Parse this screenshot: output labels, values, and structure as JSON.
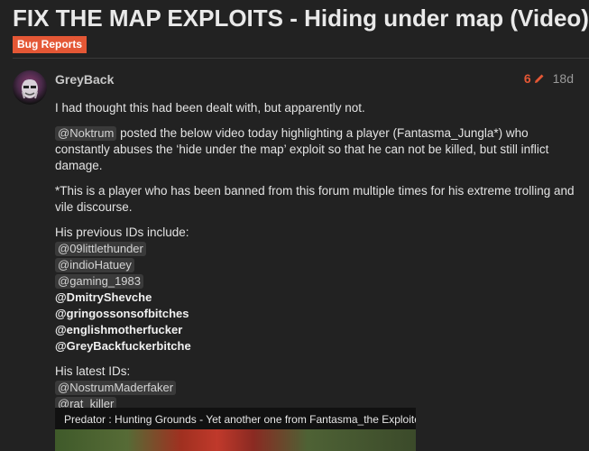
{
  "topic": {
    "title": "FIX THE MAP EXPLOITS - Hiding under map (Video)",
    "category": "Bug Reports"
  },
  "icons": {
    "edit_title": "pencil-icon",
    "edit_count": "pencil-icon"
  },
  "colors": {
    "accent": "#e45735",
    "background": "#222222",
    "mention_bg": "#3a3a3a"
  },
  "post": {
    "username": "GreyBack",
    "edit_count": "6",
    "age": "18d",
    "para1": "I had thought this had been dealt with, but apparently not.",
    "para2_mention": "@Noktrum",
    "para2_text": " posted the below video today highlighting a player (Fantasma_Jungla*) who constantly abuses the ‘hide under the map’ exploit so that he can not be killed, but still inflict damage.",
    "para3": "*This is a player who has been banned from this forum multiple times for his extreme trolling and vile discourse.",
    "previous_ids_label": "His previous IDs include:",
    "previous_ids": [
      {
        "text": "@09littlethunder",
        "style": "chip"
      },
      {
        "text": "@indioHatuey",
        "style": "chip"
      },
      {
        "text": "@gaming_1983",
        "style": "chip"
      },
      {
        "text": "@DmitryShevche",
        "style": "plain"
      },
      {
        "text": "@gringossonsofbitches",
        "style": "plain"
      },
      {
        "text": "@englishmotherfucker",
        "style": "plain"
      },
      {
        "text": "@GreyBackfuckerbitche",
        "style": "plain"
      }
    ],
    "latest_ids_label": "His latest IDs:",
    "latest_ids": [
      {
        "text": "@NostrumMaderfaker",
        "style": "chip"
      },
      {
        "text": "@rat_killer",
        "style": "chip"
      }
    ],
    "video": {
      "title": "Predator : Hunting Grounds - Yet another one from Fantasma_the Exploiter"
    }
  }
}
